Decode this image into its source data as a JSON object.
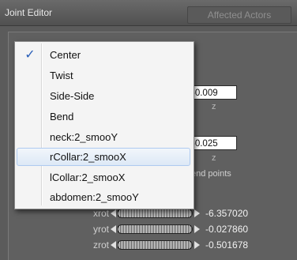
{
  "window": {
    "title": "Joint Editor",
    "tab_affected": "Affected Actors"
  },
  "fields": {
    "z1": {
      "value": "-0.009",
      "axis": "z"
    },
    "z2": {
      "value": "-0.025",
      "axis": "z"
    }
  },
  "end_points_text": "end points",
  "rotations": [
    {
      "axis": "xrot",
      "value": "-6.357020"
    },
    {
      "axis": "yrot",
      "value": "-0.027860"
    },
    {
      "axis": "zrot",
      "value": "-0.501678"
    }
  ],
  "menu": {
    "items": [
      {
        "label": "Center",
        "checked": true
      },
      {
        "label": "Twist"
      },
      {
        "label": "Side-Side"
      },
      {
        "label": "Bend"
      },
      {
        "label": "neck:2_smooY"
      },
      {
        "label": "rCollar:2_smooX",
        "hovered": true
      },
      {
        "label": "lCollar:2_smooX"
      },
      {
        "label": "abdomen:2_smooY"
      }
    ],
    "check_glyph": "✓"
  },
  "colors": {
    "menu_hover_border": "#aecaf0",
    "check_color": "#2a5fb8"
  }
}
